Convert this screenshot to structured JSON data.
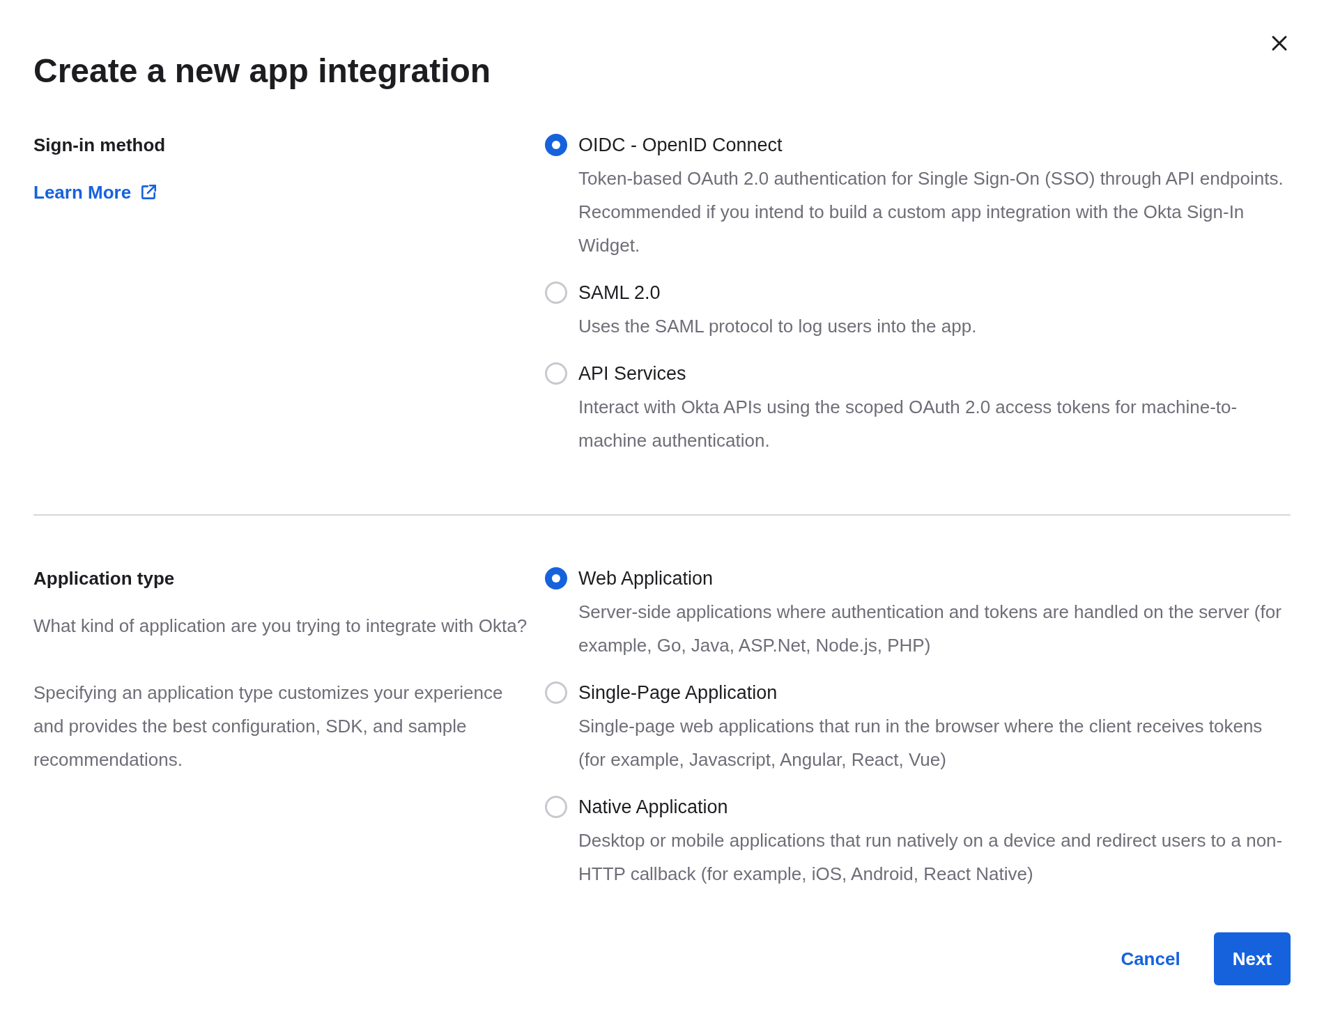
{
  "dialog": {
    "title": "Create a new app integration"
  },
  "sections": [
    {
      "label": "Sign-in method",
      "link": "Learn More",
      "options": [
        {
          "label": "OIDC - OpenID Connect",
          "description": "Token-based OAuth 2.0 authentication for Single Sign-On (SSO) through API endpoints. Recommended if you intend to build a custom app integration with the Okta Sign-In Widget.",
          "selected": true
        },
        {
          "label": "SAML 2.0",
          "description": "Uses the SAML protocol to log users into the app.",
          "selected": false
        },
        {
          "label": "API Services",
          "description": "Interact with Okta APIs using the scoped OAuth 2.0 access tokens for machine-to-machine authentication.",
          "selected": false
        }
      ]
    },
    {
      "label": "Application type",
      "paragraphs": [
        "What kind of application are you trying to integrate with Okta?",
        "Specifying an application type customizes your experience and provides the best configuration, SDK, and sample recommendations."
      ],
      "options": [
        {
          "label": "Web Application",
          "description": "Server-side applications where authentication and tokens are handled on the server (for example, Go, Java, ASP.Net, Node.js, PHP)",
          "selected": true
        },
        {
          "label": "Single-Page Application",
          "description": "Single-page web applications that run in the browser where the client receives tokens (for example, Javascript, Angular, React, Vue)",
          "selected": false
        },
        {
          "label": "Native Application",
          "description": "Desktop or mobile applications that run natively on a device and redirect users to a non-HTTP callback (for example, iOS, Android, React Native)",
          "selected": false
        }
      ]
    }
  ],
  "buttons": [
    {
      "label": "Cancel",
      "kind": "link"
    },
    {
      "label": "Next",
      "kind": "primary"
    }
  ]
}
